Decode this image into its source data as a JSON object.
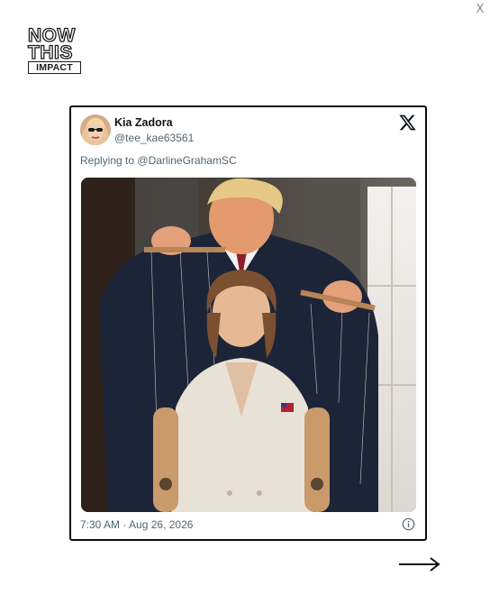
{
  "close": {
    "label": "X"
  },
  "logo": {
    "line1": "NOW",
    "line2": "THIS",
    "line3": "IMPACT"
  },
  "tweet": {
    "display_name": "Kia Zadora",
    "handle": "@tee_kae63561",
    "reply_prefix": "Replying to",
    "reply_to": "@DarlineGrahamSC",
    "timestamp": "7:30 AM · Aug 26, 2026",
    "image": {
      "alt": "Suited man holding marionette control bars with strings attached to a woman in a white blazer with wooden puppet arms"
    }
  },
  "icons": {
    "x_logo": "x-logo-icon",
    "info": "info-icon",
    "next": "arrow-right-icon"
  },
  "colors": {
    "muted_text": "#536471",
    "card_border": "#0c0c0c",
    "primary_text": "#0f1419"
  }
}
